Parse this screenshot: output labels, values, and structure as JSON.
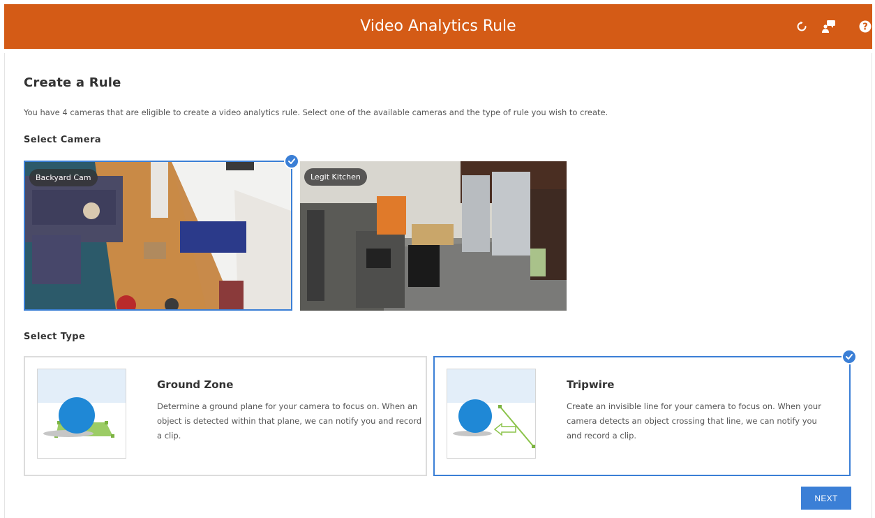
{
  "header": {
    "title": "Video Analytics Rule",
    "icons": [
      "refresh-icon",
      "chat-icon",
      "help-icon"
    ]
  },
  "page": {
    "title": "Create a Rule",
    "intro": "You have 4 cameras that are eligible to create a video analytics rule. Select one of the available cameras and the type of rule you wish to create."
  },
  "select_camera": {
    "label": "Select Camera",
    "cameras": [
      {
        "name": "Backyard Cam",
        "selected": true
      },
      {
        "name": "Legit Kitchen",
        "selected": false
      }
    ]
  },
  "select_type": {
    "label": "Select Type",
    "types": [
      {
        "title": "Ground Zone",
        "description": "Determine a ground plane for your camera to focus on. When an object is detected within that plane, we can notify you and record a clip.",
        "selected": false
      },
      {
        "title": "Tripwire",
        "description": "Create an invisible line for your camera to focus on. When your camera detects an object crossing that line, we can notify you and record a clip.",
        "selected": true
      }
    ]
  },
  "footer": {
    "next_label": "NEXT"
  },
  "colors": {
    "header_bg": "#d45b16",
    "accent": "#3b7fd6",
    "zone_green": "#8bc34a"
  }
}
